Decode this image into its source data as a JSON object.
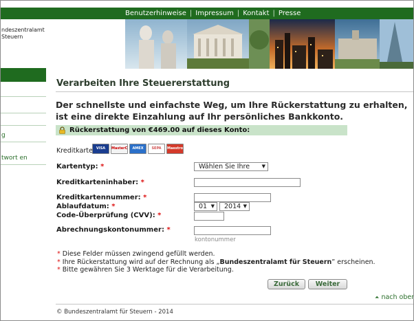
{
  "topnav": {
    "links": [
      "Benutzerhinweise",
      "Impressum",
      "Kontakt",
      "Presse"
    ],
    "separator": "|"
  },
  "logo": {
    "line1": "ndeszentralamt",
    "line2": "Steuern"
  },
  "sidebar": {
    "items": [
      "g",
      "twort en"
    ]
  },
  "main": {
    "title": "Verarbeiten Ihre Steuererstattung",
    "intro": "Der schnellste und einfachste Weg, um Ihre Rückerstattung zu erhalten, ist eine direkte Einzahlung auf Ihr persönliches Bankkonto.",
    "refund_text": "Rückerstattung von €469.00 auf dieses Konto:"
  },
  "cards": {
    "label": "Kreditkarte",
    "brands": [
      "VISA",
      "MasterCard",
      "AMEX",
      "SEPA",
      "Maestro"
    ]
  },
  "form": {
    "required_mark": "*",
    "card_type_label": "Kartentyp:",
    "card_type_value": "Wählen Sie Ihre",
    "holder_label": "Kreditkarteninhaber:",
    "number_label": "Kreditkartennummer:",
    "expiry_label": "Ablaufdatum:",
    "expiry_month": "01",
    "expiry_year": "2014",
    "cvv_label": "Code-Überprüfung (CVV):",
    "billing_label": "Abrechnungskontonummer:",
    "billing_hint": "kontonummer"
  },
  "notes": {
    "star": "*",
    "line1": "Diese Felder müssen zwingend gefüllt werden.",
    "line2_pre": "Ihre Rückerstattung wird auf der Rechnung als „",
    "line2_bold": "Bundeszentralamt für Steuern",
    "line2_post": "” erscheinen.",
    "line3": "Bitte gewähren Sie 3 Werktage für die Verarbeitung."
  },
  "buttons": {
    "back": "Zurück",
    "next": "Weiter"
  },
  "footer": {
    "top_link": "nach oben",
    "copyright": "© Bundeszentralamt für Steuern - 2014"
  },
  "colors": {
    "brand_green": "#1f6b1f",
    "refund_bar": "#c9e3c9",
    "required_red": "#dd1111"
  }
}
